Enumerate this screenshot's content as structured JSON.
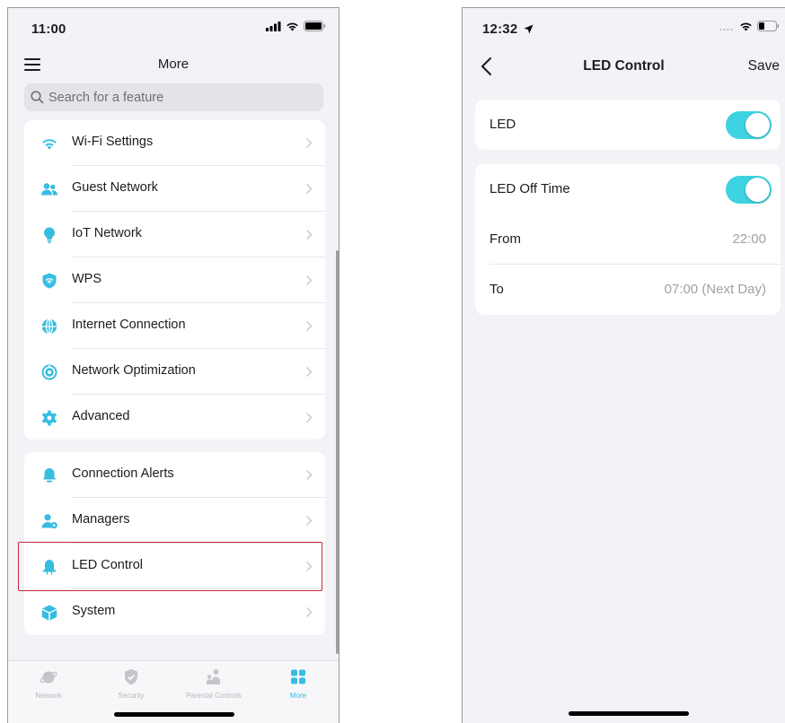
{
  "left_screen": {
    "status": {
      "time": "11:00"
    },
    "header": {
      "title": "More"
    },
    "search": {
      "placeholder": "Search for a feature"
    },
    "groups": [
      {
        "items": [
          {
            "label": "Wi-Fi Settings",
            "icon": "wifi-icon"
          },
          {
            "label": "Guest Network",
            "icon": "guest-users-icon"
          },
          {
            "label": "IoT Network",
            "icon": "lightbulb-icon"
          },
          {
            "label": "WPS",
            "icon": "wps-shield-icon"
          },
          {
            "label": "Internet Connection",
            "icon": "globe-icon"
          },
          {
            "label": "Network Optimization",
            "icon": "optimization-icon"
          },
          {
            "label": "Advanced",
            "icon": "gear-icon"
          }
        ]
      },
      {
        "items": [
          {
            "label": "Connection Alerts",
            "icon": "bell-icon"
          },
          {
            "label": "Managers",
            "icon": "manager-icon"
          },
          {
            "label": "LED Control",
            "icon": "led-icon",
            "highlighted": true
          },
          {
            "label": "System",
            "icon": "cube-icon"
          }
        ]
      }
    ],
    "tabbar": {
      "tabs": [
        {
          "label": "Network",
          "icon": "planet-icon",
          "active": false
        },
        {
          "label": "Security",
          "icon": "shield-check-icon",
          "active": false
        },
        {
          "label": "Parental Controls",
          "icon": "family-icon",
          "active": false
        },
        {
          "label": "More",
          "icon": "grid-icon",
          "active": true
        }
      ]
    }
  },
  "right_screen": {
    "status": {
      "time": "12:32"
    },
    "header": {
      "title": "LED Control",
      "save_label": "Save"
    },
    "led": {
      "label": "LED",
      "enabled": true
    },
    "off_time": {
      "label": "LED Off Time",
      "enabled": true,
      "from_label": "From",
      "from_value": "22:00",
      "to_label": "To",
      "to_value": "07:00 (Next Day)"
    }
  },
  "colors": {
    "accent": "#3ed3e0",
    "icon_blue": "#36bde0",
    "highlight_border": "#c6283e",
    "background": "#f2f2f7"
  }
}
